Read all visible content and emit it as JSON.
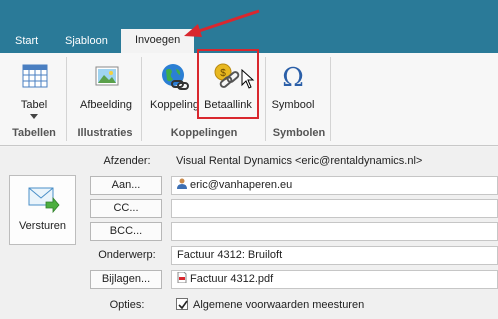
{
  "tabs": [
    {
      "label": "Start",
      "active": false
    },
    {
      "label": "Sjabloon",
      "active": false
    },
    {
      "label": "Invoegen",
      "active": true
    }
  ],
  "ribbon": {
    "buttons": {
      "tabel": "Tabel",
      "afbeelding": "Afbeelding",
      "koppeling": "Koppeling",
      "betaallink": "Betaallink",
      "symbool": "Symbool"
    },
    "groups": {
      "tabellen": "Tabellen",
      "illustraties": "Illustraties",
      "koppelingen": "Koppelingen",
      "symbolen": "Symbolen"
    }
  },
  "compose": {
    "send_label": "Versturen",
    "afzender_label": "Afzender:",
    "afzender_value": "Visual Rental Dynamics <eric@rentaldynamics.nl>",
    "aan_label": "Aan...",
    "aan_value": "eric@vanhaperen.eu",
    "cc_label": "CC...",
    "cc_value": "",
    "bcc_label": "BCC...",
    "bcc_value": "",
    "onderwerp_label": "Onderwerp:",
    "onderwerp_value": "Factuur 4312: Bruiloft",
    "bijlagen_label": "Bijlagen...",
    "bijlagen_value": "Factuur 4312.pdf",
    "opties_label": "Opties:",
    "opties_value": "Algemene voorwaarden meesturen",
    "opties_checked": true
  },
  "colors": {
    "tabbar": "#2a7a98",
    "highlight": "#d9272e"
  }
}
